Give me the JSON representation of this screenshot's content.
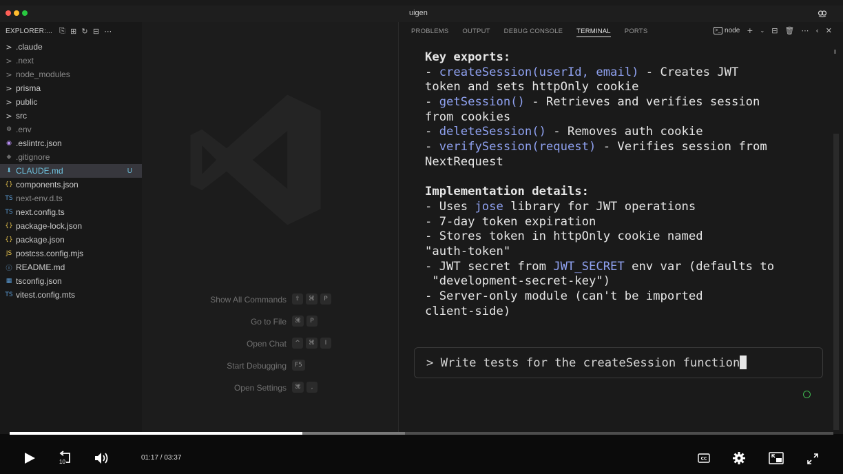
{
  "window": {
    "title": "uigen"
  },
  "explorer": {
    "header": "EXPLORER:...",
    "items": [
      {
        "label": ".claude",
        "icon": "chevron-right-icon",
        "glyph": ">",
        "kind": "folder",
        "dim": false
      },
      {
        "label": ".next",
        "icon": "chevron-right-icon",
        "glyph": ">",
        "kind": "folder",
        "dim": true
      },
      {
        "label": "node_modules",
        "icon": "chevron-right-icon",
        "glyph": ">",
        "kind": "folder",
        "dim": true
      },
      {
        "label": "prisma",
        "icon": "chevron-right-icon",
        "glyph": ">",
        "kind": "folder",
        "dim": false
      },
      {
        "label": "public",
        "icon": "chevron-right-icon",
        "glyph": ">",
        "kind": "folder",
        "dim": false
      },
      {
        "label": "src",
        "icon": "chevron-right-icon",
        "glyph": ">",
        "kind": "folder",
        "dim": false
      },
      {
        "label": ".env",
        "icon": "gear-icon",
        "glyph": "⚙",
        "kind": "file",
        "dim": true,
        "color": "#9d9d9d"
      },
      {
        "label": ".eslintrc.json",
        "icon": "eslint-icon",
        "glyph": "◉",
        "kind": "file",
        "dim": false,
        "color": "#b58cf0"
      },
      {
        "label": ".gitignore",
        "icon": "git-icon",
        "glyph": "◆",
        "kind": "file",
        "dim": true,
        "color": "#6b6b6b"
      },
      {
        "label": "CLAUDE.md",
        "icon": "markdown-icon",
        "glyph": "⬇",
        "kind": "file",
        "dim": false,
        "selected": true,
        "badge": "U",
        "color": "#6fc3df"
      },
      {
        "label": "components.json",
        "icon": "json-icon",
        "glyph": "{}",
        "kind": "file",
        "dim": false,
        "color": "#e2c04c"
      },
      {
        "label": "next-env.d.ts",
        "icon": "typescript-icon",
        "glyph": "TS",
        "kind": "file",
        "dim": true,
        "color": "#5a9bd5"
      },
      {
        "label": "next.config.ts",
        "icon": "typescript-icon",
        "glyph": "TS",
        "kind": "file",
        "dim": false,
        "color": "#5a9bd5"
      },
      {
        "label": "package-lock.json",
        "icon": "json-icon",
        "glyph": "{}",
        "kind": "file",
        "dim": false,
        "color": "#e2c04c"
      },
      {
        "label": "package.json",
        "icon": "json-icon",
        "glyph": "{}",
        "kind": "file",
        "dim": false,
        "color": "#e2c04c"
      },
      {
        "label": "postcss.config.mjs",
        "icon": "javascript-icon",
        "glyph": "JS",
        "kind": "file",
        "dim": false,
        "color": "#e2c04c"
      },
      {
        "label": "README.md",
        "icon": "info-icon",
        "glyph": "ⓘ",
        "kind": "file",
        "dim": false,
        "color": "#6fa8dc"
      },
      {
        "label": "tsconfig.json",
        "icon": "tsconfig-icon",
        "glyph": "▦",
        "kind": "file",
        "dim": false,
        "color": "#5a9bd5"
      },
      {
        "label": "vitest.config.mts",
        "icon": "typescript-icon",
        "glyph": "TS",
        "kind": "file",
        "dim": false,
        "color": "#5a9bd5"
      }
    ]
  },
  "editor": {
    "shortcuts": [
      {
        "label": "Show All Commands",
        "keys": [
          "⇧",
          "⌘",
          "P"
        ]
      },
      {
        "label": "Go to File",
        "keys": [
          "⌘",
          "P"
        ]
      },
      {
        "label": "Open Chat",
        "keys": [
          "^",
          "⌘",
          "I"
        ]
      },
      {
        "label": "Start Debugging",
        "keys": [
          "F5"
        ]
      },
      {
        "label": "Open Settings",
        "keys": [
          "⌘",
          ","
        ]
      }
    ]
  },
  "panel": {
    "tabs": [
      "PROBLEMS",
      "OUTPUT",
      "DEBUG CONSOLE",
      "TERMINAL",
      "PORTS"
    ],
    "active_tab": "TERMINAL",
    "terminal_name": "node",
    "terminal_lines": [
      [
        {
          "t": "Key exports:",
          "s": "bold"
        }
      ],
      [
        {
          "t": "- "
        },
        {
          "t": "createSession(userId, email)",
          "s": "hl"
        },
        {
          "t": " - Creates JWT"
        }
      ],
      [
        {
          "t": "token and sets httpOnly cookie"
        }
      ],
      [
        {
          "t": "- "
        },
        {
          "t": "getSession()",
          "s": "hl"
        },
        {
          "t": " - Retrieves and verifies session"
        }
      ],
      [
        {
          "t": "from cookies"
        }
      ],
      [
        {
          "t": "- "
        },
        {
          "t": "deleteSession()",
          "s": "hl"
        },
        {
          "t": " - Removes auth cookie"
        }
      ],
      [
        {
          "t": "- "
        },
        {
          "t": "verifySession(request)",
          "s": "hl"
        },
        {
          "t": " - Verifies session from"
        }
      ],
      [
        {
          "t": "NextRequest"
        }
      ],
      [
        {
          "t": ""
        }
      ],
      [
        {
          "t": "Implementation details:",
          "s": "bold"
        }
      ],
      [
        {
          "t": "- Uses "
        },
        {
          "t": "jose",
          "s": "hl"
        },
        {
          "t": " library for JWT operations"
        }
      ],
      [
        {
          "t": "- 7-day token expiration"
        }
      ],
      [
        {
          "t": "- Stores token in httpOnly cookie named"
        }
      ],
      [
        {
          "t": "\"auth-token\""
        }
      ],
      [
        {
          "t": "- JWT secret from "
        },
        {
          "t": "JWT_SECRET",
          "s": "hl"
        },
        {
          "t": " env var (defaults to"
        }
      ],
      [
        {
          "t": " \"development-secret-key\")"
        }
      ],
      [
        {
          "t": "- Server-only module (can't be imported"
        }
      ],
      [
        {
          "t": "client-side)"
        }
      ]
    ],
    "prompt_text": "> Write tests for the createSession function"
  },
  "player": {
    "time_current": "01:17",
    "time_total": "03:37",
    "time_display": "01:17 / 03:37",
    "progress_fraction": 0.355,
    "buffered_fraction": 0.48,
    "skip_label": "10"
  },
  "colors": {
    "accent": "#6fc3df",
    "highlight": "#8fa1f0",
    "status_ok": "#3fb950"
  }
}
